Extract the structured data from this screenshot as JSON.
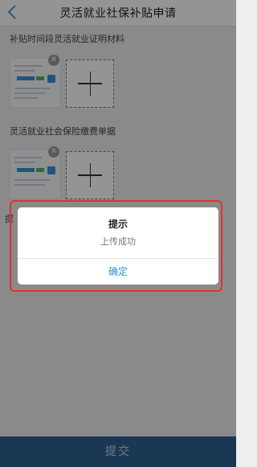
{
  "header": {
    "title": "灵活就业社保补贴申请",
    "back_icon": "chevron-left-icon"
  },
  "sections": [
    {
      "label": "补贴时间段灵活就业证明材料"
    },
    {
      "label": "灵活就业社会保险缴费单据"
    }
  ],
  "partially_hidden_label": "提",
  "dialog": {
    "title": "提示",
    "message": "上传成功",
    "confirm_label": "确定",
    "highlight_color": "#e4322b"
  },
  "submit": {
    "label": "提交"
  },
  "colors": {
    "accent": "#2f8fd8",
    "submit_bar": "#2d5f8f"
  }
}
